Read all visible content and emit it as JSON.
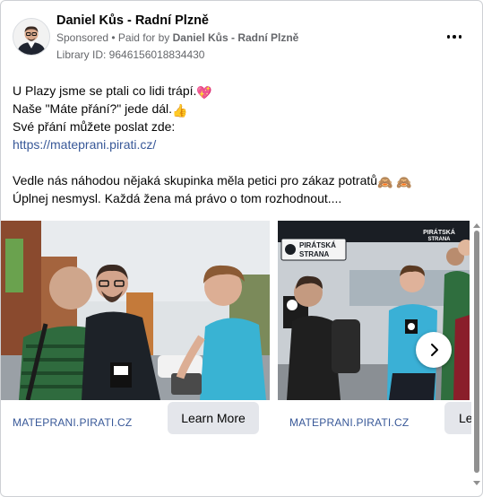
{
  "ad": {
    "page_name": "Daniel Kůs - Radní Plzně",
    "sponsored_label": "Sponsored",
    "paid_for_prefix": "• Paid for by",
    "paid_for_name": "Daniel Kůs - Radní Plzně",
    "library_id": "Library ID: 9646156018834430",
    "more_options_icon": "more-horizontal-icon"
  },
  "body": {
    "line1": "U Plazy jsme se ptali co lidi trápí.",
    "line1_emoji": "💖",
    "line2": "Naše \"Máte přání?\" jede dál.",
    "line2_emoji": "👍",
    "line3": "Své přání můžete poslat zde:",
    "link": "https://mateprani.pirati.cz/",
    "line5": "Vedle nás náhodou nějaká skupinka měla petici pro zákaz potratů",
    "line5_emoji": "🙈 🙈",
    "line6": "Úplnej nesmysl. Každá žena má právo o tom rozhodnout...."
  },
  "carousel": {
    "cards": [
      {
        "domain": "MATEPRANI.PIRATI.CZ",
        "cta": "Learn More"
      },
      {
        "domain": "MATEPRANI.PIRATI.CZ",
        "cta": "Le",
        "banner_text_1": "PIRÁTSKÁ",
        "banner_text_2": "STRANA",
        "tent_text_1": "PIRÁTSKÁ",
        "tent_text_2": "STRANA"
      }
    ],
    "next_icon": "chevron-right-icon"
  }
}
